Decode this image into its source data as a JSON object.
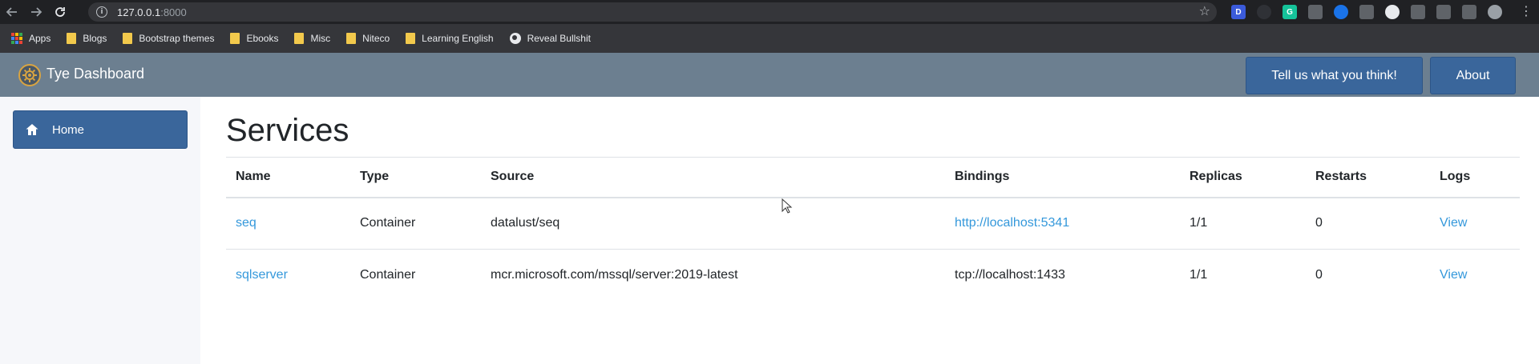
{
  "browser": {
    "url_host": "127.0.0.1",
    "url_port": ":8000",
    "extensions": [
      {
        "icon": "d-extension-icon",
        "label": "D",
        "color": "#3b5bdb"
      },
      {
        "icon": "dark-mode-icon",
        "label": "",
        "color": "#2f3136"
      },
      {
        "icon": "grammarly-icon",
        "label": "G",
        "color": "#15c39a"
      },
      {
        "icon": "lightbulb-icon",
        "label": "",
        "color": "#5f6368"
      },
      {
        "icon": "blue-circle-icon",
        "label": "",
        "color": "#1a73e8"
      },
      {
        "icon": "screenshot-icon",
        "label": "",
        "color": "#5f6368"
      },
      {
        "icon": "white-circle-icon",
        "label": "",
        "color": "#e8eaed"
      },
      {
        "icon": "reader-icon",
        "label": "",
        "color": "#5f6368"
      },
      {
        "icon": "target-icon",
        "label": "",
        "color": "#5f6368"
      },
      {
        "icon": "puzzle-icon",
        "label": "",
        "color": "#5f6368"
      },
      {
        "icon": "profile-avatar-icon",
        "label": "",
        "color": "#9aa0a6"
      }
    ]
  },
  "bookmarks": {
    "apps": "Apps",
    "items": [
      "Blogs",
      "Bootstrap themes",
      "Ebooks",
      "Misc",
      "Niteco",
      "Learning English"
    ],
    "reveal": "Reveal Bullshit"
  },
  "header": {
    "brand": "Tye Dashboard",
    "feedback_label": "Tell us what you think!",
    "about_label": "About"
  },
  "sidebar": {
    "home_label": "Home"
  },
  "main": {
    "title": "Services",
    "columns": [
      "Name",
      "Type",
      "Source",
      "Bindings",
      "Replicas",
      "Restarts",
      "Logs"
    ],
    "rows": [
      {
        "name": "seq",
        "type": "Container",
        "source": "datalust/seq",
        "binding": "http://localhost:5341",
        "binding_is_link": true,
        "replicas": "1/1",
        "restarts": "0",
        "logs": "View"
      },
      {
        "name": "sqlserver",
        "type": "Container",
        "source": "mcr.microsoft.com/mssql/server:2019-latest",
        "binding": "tcp://localhost:1433",
        "binding_is_link": false,
        "replicas": "1/1",
        "restarts": "0",
        "logs": "View"
      }
    ]
  },
  "colors": {
    "header_bg": "#6c7f90",
    "button_bg": "#3a669b",
    "link": "#3498db",
    "sidebar_bg": "#f6f7fa"
  }
}
